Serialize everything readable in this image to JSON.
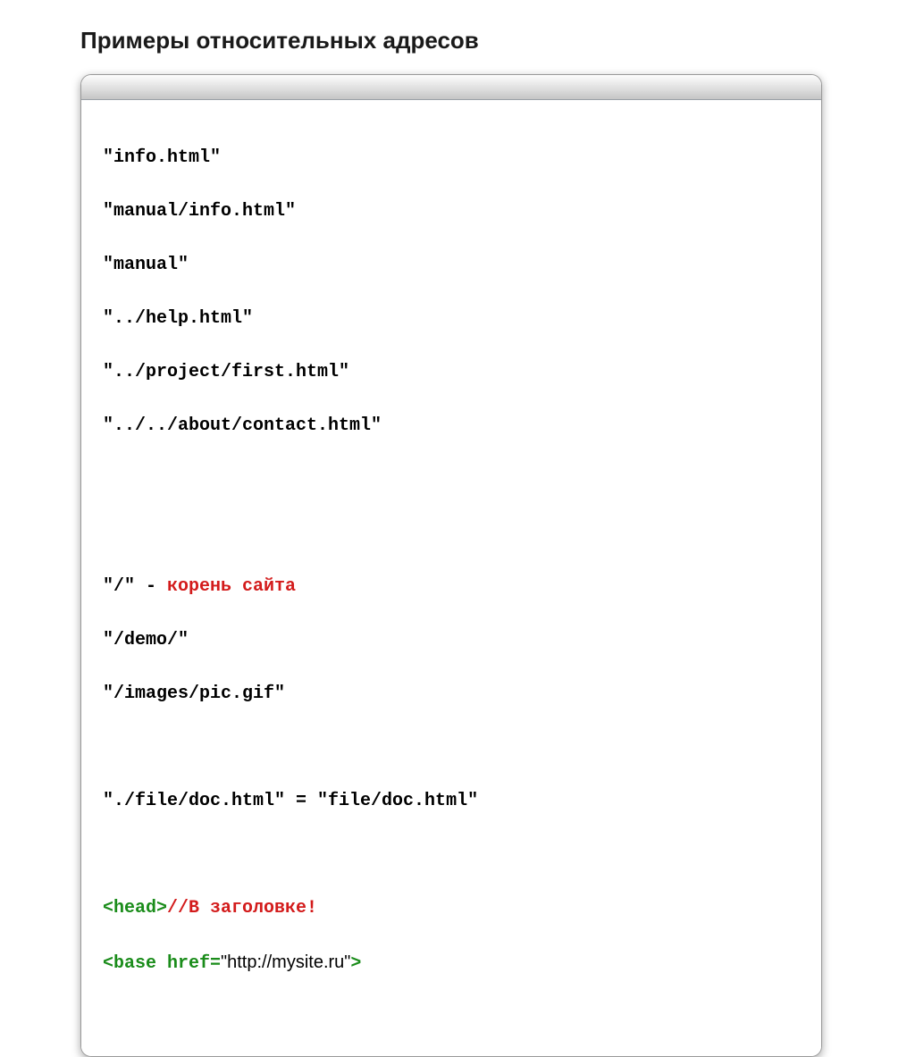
{
  "title": "Примеры относительных адресов",
  "code": {
    "l1": "\"info.html\"",
    "l2": "\"manual/info.html\"",
    "l3": "\"manual\"",
    "l4": "\"../help.html\"",
    "l5": "\"../project/first.html\"",
    "l6": "\"../../about/contact.html\"",
    "root": {
      "a": "\"/\" - ",
      "b": "корень сайта"
    },
    "l8": "\"/demo/\"",
    "l9": "\"/images/pic.gif\"",
    "l10": "\"./file/doc.html\" = \"file/doc.html\"",
    "head": {
      "a": "<head>",
      "b": "//В заголовке!"
    },
    "base": {
      "a": "<base href=",
      "b": "\"http://mysite.ru\"",
      "c": ">"
    }
  }
}
